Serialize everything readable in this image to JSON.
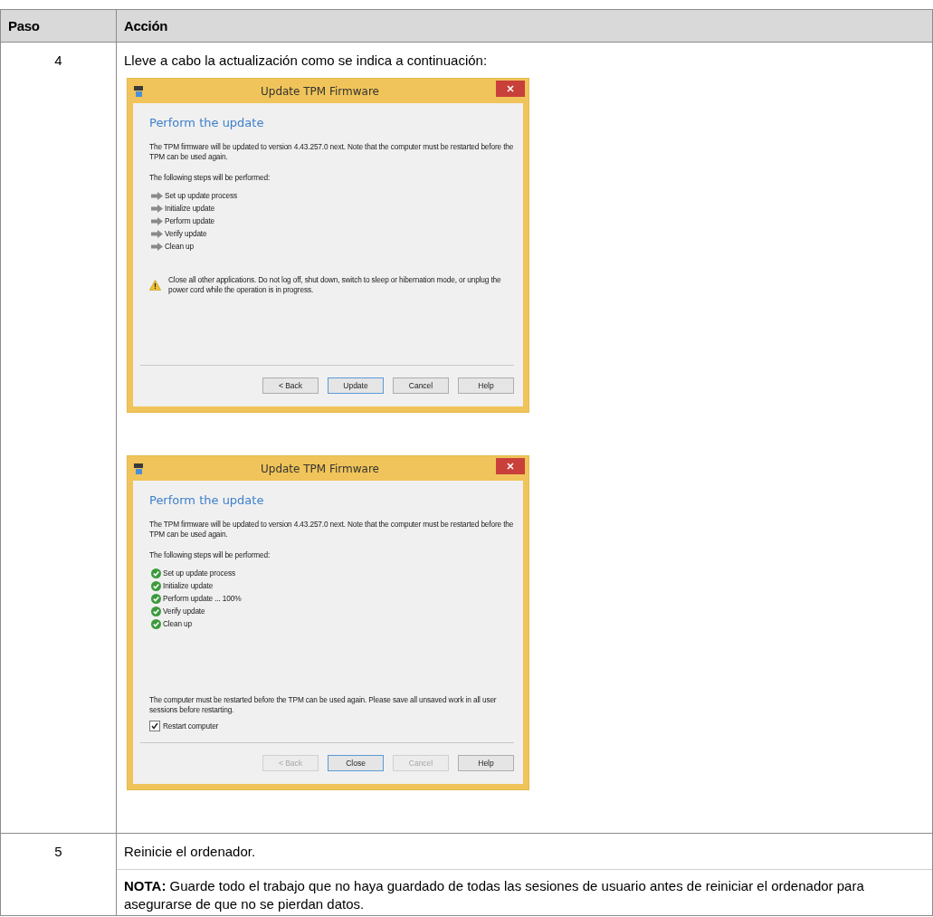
{
  "table": {
    "columns": [
      "Paso",
      "Acción"
    ],
    "rows": [
      {
        "step": "4",
        "text": "Lleve a cabo la actualización como se indica a continuación:",
        "dialogs": [
          {
            "title": "Update TPM Firmware",
            "heading": "Perform the update",
            "intro": "The TPM firmware will be updated to version 4.43.257.0 next. Note that the computer must be restarted before the TPM can be used again.",
            "steps_label": "The following steps will be performed:",
            "steps": [
              {
                "label": "Set up update process",
                "done": false
              },
              {
                "label": "Initialize update",
                "done": false
              },
              {
                "label": "Perform update",
                "done": false
              },
              {
                "label": "Verify update",
                "done": false
              },
              {
                "label": "Clean up",
                "done": false
              }
            ],
            "warning": "Close all other applications. Do not log off, shut down, switch to sleep or hibernation mode, or unplug the power cord while the operation is in progress.",
            "buttons": [
              {
                "label": "< Back",
                "disabled": false,
                "default": false
              },
              {
                "label": "Update",
                "disabled": false,
                "default": true
              },
              {
                "label": "Cancel",
                "disabled": false,
                "default": false
              },
              {
                "label": "Help",
                "disabled": false,
                "default": false
              }
            ]
          },
          {
            "title": "Update TPM Firmware",
            "heading": "Perform the update",
            "intro": "The TPM firmware will be updated to version 4.43.257.0 next. Note that the computer must be restarted before the TPM can be used again.",
            "steps_label": "The following steps will be performed:",
            "steps": [
              {
                "label": "Set up update process",
                "done": true
              },
              {
                "label": "Initialize update",
                "done": true
              },
              {
                "label": "Perform update ... 100%",
                "done": true
              },
              {
                "label": "Verify update",
                "done": true
              },
              {
                "label": "Clean up",
                "done": true
              }
            ],
            "notice": "The computer must be restarted before the TPM can be used again. Please save all unsaved work in all user sessions before restarting.",
            "checkbox": {
              "label": "Restart computer",
              "checked": true
            },
            "buttons": [
              {
                "label": "< Back",
                "disabled": true,
                "default": false
              },
              {
                "label": "Close",
                "disabled": false,
                "default": true
              },
              {
                "label": "Cancel",
                "disabled": true,
                "default": false
              },
              {
                "label": "Help",
                "disabled": false,
                "default": false
              }
            ]
          }
        ]
      },
      {
        "step": "5",
        "text": "Reinicie el ordenador.",
        "note": "**NOTA:** Guarde todo el trabajo que no haya guardado de todas las sesiones de usuario antes de reiniciar el ordenador para asegurarse de que no se pierdan datos."
      }
    ]
  }
}
